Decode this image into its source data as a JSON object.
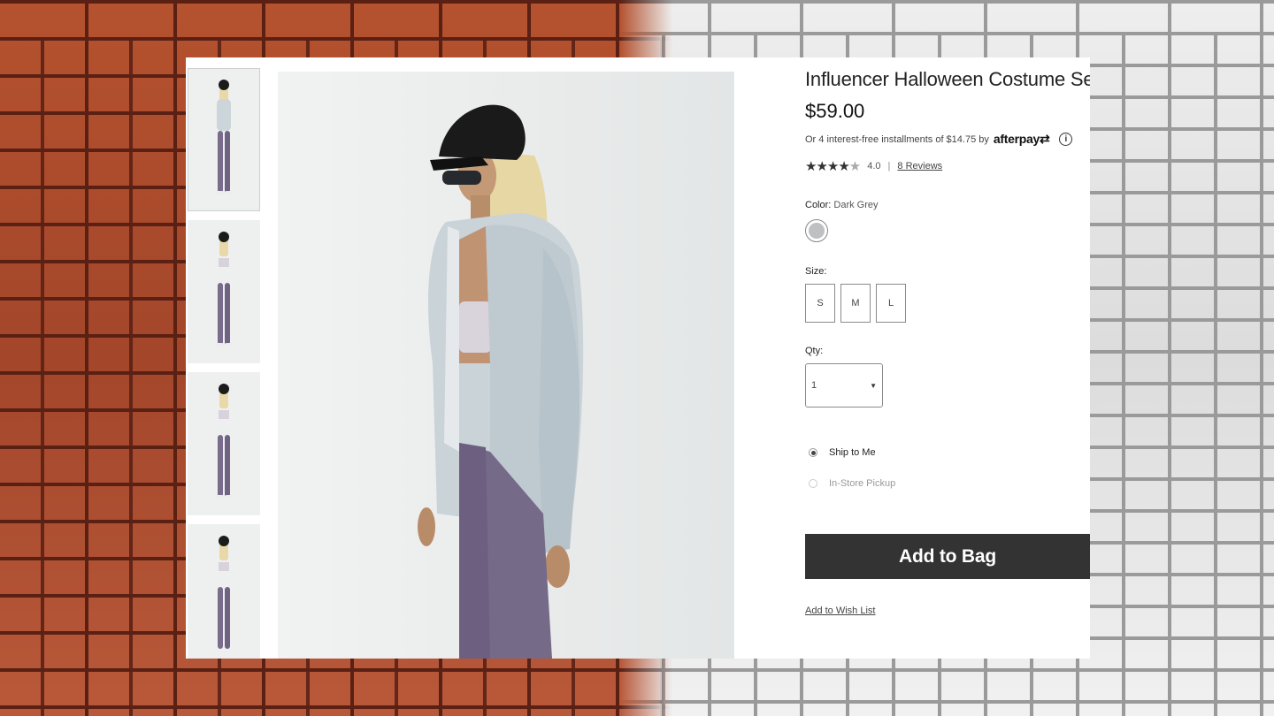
{
  "product": {
    "title": "Influencer Halloween Costume Set",
    "price": "$59.00",
    "afterpay_text": "Or 4 interest-free installments of $14.75 by",
    "afterpay_brand": "afterpay",
    "afterpay_mark": "⇄",
    "info_glyph": "i",
    "rating": {
      "stars_filled": "★★★★",
      "stars_empty": "★",
      "stars_value": 4.0,
      "value": "4.0",
      "separator": "|",
      "reviews_label": "8 Reviews"
    }
  },
  "color": {
    "label": "Color:",
    "value": "Dark Grey",
    "swatch_color": "#bfc0c3"
  },
  "size": {
    "label": "Size:",
    "options": [
      "S",
      "M",
      "L"
    ]
  },
  "qty": {
    "label": "Qty:",
    "value": "1",
    "arrow": "▼"
  },
  "delivery": {
    "options": [
      {
        "label": "Ship to Me",
        "selected": true
      },
      {
        "label": "In-Store Pickup",
        "selected": false
      }
    ]
  },
  "actions": {
    "add_to_bag": "Add to Bag",
    "add_to_wishlist": "Add to Wish List"
  },
  "thumbnails": {
    "count": 4,
    "active_index": 0
  },
  "colors": {
    "button_bg": "#333333",
    "hoodie": "#c9d3d8",
    "leggings": "#7a6c8c",
    "cap": "#1b1b1b",
    "hair": "#e9d9a8"
  }
}
